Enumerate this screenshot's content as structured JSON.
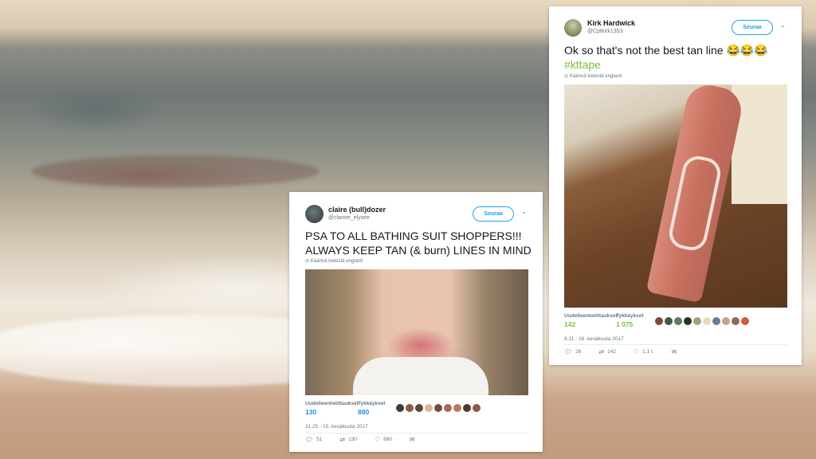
{
  "tweet_left": {
    "name": "claire (bull)dozer",
    "handle": "@clairee_elysee",
    "follow_label": "Seuraa",
    "chevron": "⌄",
    "text": "PSA TO ALL BATHING SUIT SHOPPERS!!! ALWAYS KEEP TAN (& burn) LINES IN MIND",
    "translate": "Käännä kielestä englanti",
    "retweets_label": "Uudelleentwiittaukset",
    "retweets": "130",
    "likes_label": "Tykkäykset",
    "likes": "880",
    "date": "21.25 - 15. kesäkuuta 2017",
    "reply_count": "51",
    "retweet_count": "130",
    "like_count": "880",
    "liker_colors": [
      "#3b3b3b",
      "#8b5a44",
      "#5a4a3a",
      "#d7b59b",
      "#6b4e3b",
      "#a86a55",
      "#b77a63",
      "#4d3b33",
      "#8c5b4a"
    ]
  },
  "tweet_right": {
    "name": "Kirk Hardwick",
    "handle": "@Cptkirk1353",
    "follow_label": "Seuraa",
    "chevron": "⌄",
    "text": "Ok so that's not the best tan line 😂😂😂",
    "hashtag": "#kttape",
    "translate": "Käännä kielestä englanti",
    "retweets_label": "Uudelleentwiittaukset",
    "retweets": "142",
    "likes_label": "Tykkäykset",
    "likes": "1 075",
    "date": "9.11 - 18. kesäkuuta 2017",
    "reply_count": "26",
    "retweet_count": "142",
    "like_count": "1,1 t.",
    "liker_colors": [
      "#7a4a3a",
      "#3f5a4a",
      "#5e7b5a",
      "#2e2e2e",
      "#a0a37a",
      "#e9d9c9",
      "#6b7c9a",
      "#c8a28a",
      "#8a6a5a",
      "#d05a3a"
    ]
  },
  "icons": {
    "reply": "reply-icon",
    "retweet": "retweet-icon",
    "like": "heart-icon",
    "dm": "envelope-icon",
    "translate": "globe-icon"
  }
}
